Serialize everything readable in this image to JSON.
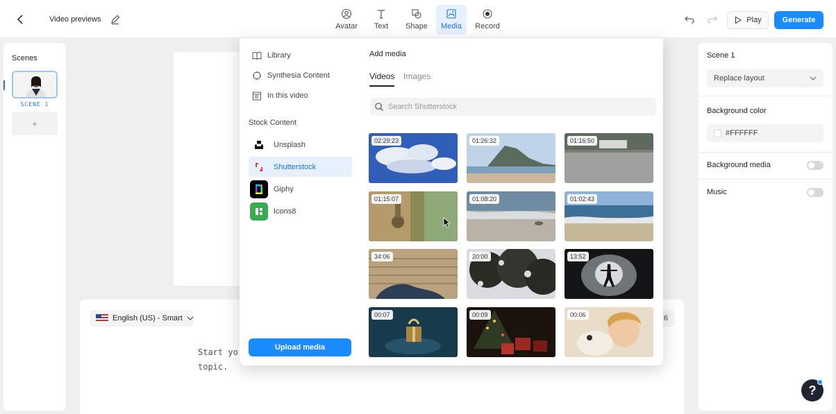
{
  "header": {
    "title": "Video previews",
    "tools": [
      {
        "label": "Avatar",
        "icon": "avatar-icon"
      },
      {
        "label": "Text",
        "icon": "text-icon"
      },
      {
        "label": "Shape",
        "icon": "shape-icon"
      },
      {
        "label": "Media",
        "icon": "media-icon",
        "active": true
      },
      {
        "label": "Record",
        "icon": "record-icon"
      }
    ],
    "play_label": "Play",
    "generate_label": "Generate",
    "accent_color": "#1a8cff"
  },
  "scenes": {
    "title": "Scenes",
    "items": [
      {
        "label": "SCENE 1",
        "selected": true
      }
    ],
    "add_label": "+"
  },
  "script": {
    "language": "English (US) - Smart",
    "text_line1": "Start yo",
    "text_line2": "topic.",
    "right_chip": "6"
  },
  "media_panel": {
    "library": "Library",
    "synthesia_content": "Synthesia Content",
    "in_this_video": "In this video",
    "stock_heading": "Stock Content",
    "stock_sources": [
      {
        "label": "Unsplash",
        "icon": "unsplash-icon",
        "active": false
      },
      {
        "label": "Shutterstock",
        "icon": "shutterstock-icon",
        "active": true
      },
      {
        "label": "Giphy",
        "icon": "giphy-icon",
        "active": false
      },
      {
        "label": "Icons8",
        "icon": "icons8-icon",
        "active": false
      }
    ],
    "upload_label": "Upload media",
    "add_media_title": "Add media",
    "tabs": [
      {
        "label": "Videos",
        "active": true
      },
      {
        "label": "Images",
        "active": false
      }
    ],
    "search_placeholder": "Search Shutterstock",
    "videos": [
      {
        "duration": "02:29:23",
        "scene": "clouds"
      },
      {
        "duration": "01:26:32",
        "scene": "coast"
      },
      {
        "duration": "01:16:50",
        "scene": "road"
      },
      {
        "duration": "01:15:07",
        "scene": "faucet"
      },
      {
        "duration": "01:08:20",
        "scene": "beach"
      },
      {
        "duration": "01:02:43",
        "scene": "waves"
      },
      {
        "duration": "34:06",
        "scene": "wall"
      },
      {
        "duration": "20:00",
        "scene": "tree"
      },
      {
        "duration": "13:52",
        "scene": "silhouette"
      },
      {
        "duration": "00:07",
        "scene": "gift"
      },
      {
        "duration": "00:09",
        "scene": "christmas"
      },
      {
        "duration": "00:06",
        "scene": "child"
      }
    ]
  },
  "right_panel": {
    "title": "Scene 1",
    "layout_label": "Replace layout",
    "background_color_label": "Background color",
    "background_color_value": "#FFFFFF",
    "background_media_label": "Background media",
    "background_media_on": false,
    "music_label": "Music",
    "music_on": false
  },
  "help_label": "?"
}
